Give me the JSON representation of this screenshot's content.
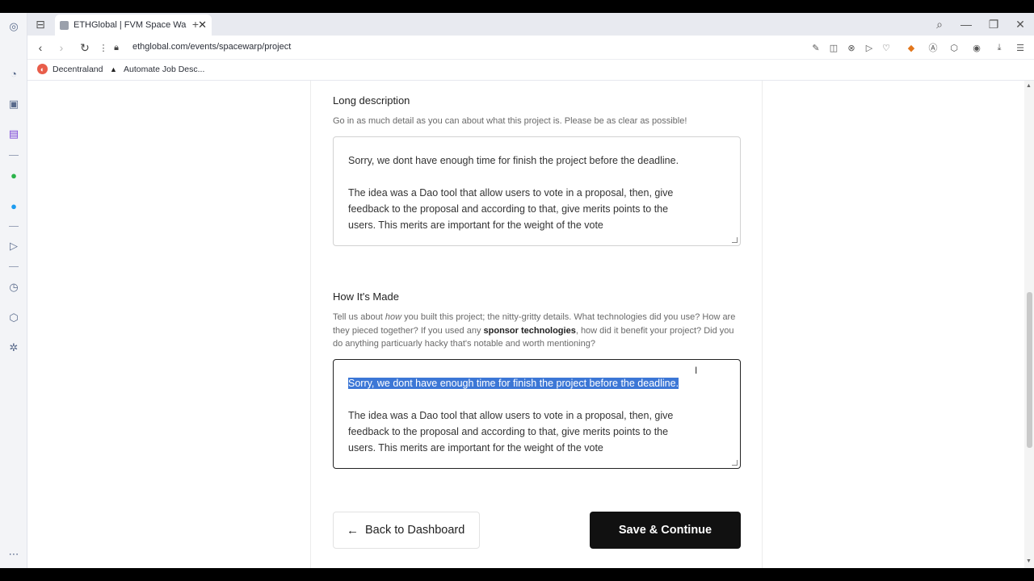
{
  "browser": {
    "tab_title": "ETHGlobal | FVM Space Wa",
    "url": "ethglobal.com/events/spacewarp/project",
    "bookmarks": [
      {
        "label": "Decentraland"
      },
      {
        "label": "Automate Job Desc..."
      }
    ]
  },
  "form": {
    "long_description": {
      "title": "Long description",
      "help": "Go in as much detail as you can about what this project is. Please be as clear as possible!",
      "line1": "Sorry, we dont have enough time for finish the project before the deadline.",
      "para2_line1": "The idea was a Dao tool that allow users to vote in a proposal, then, give",
      "para2_line2": "feedback to the proposal and according to that, give merits points to the",
      "para2_line3": "users. This merits are important for the weight of the vote"
    },
    "how_its_made": {
      "title": "How It's Made",
      "help_part1": "Tell us about ",
      "help_em": "how",
      "help_part2": " you built this project; the nitty-gritty details. What technologies did you use? How are they pieced together? If you used any ",
      "help_bold": "sponsor technologies",
      "help_part3": ", how did it benefit your project? Did you do anything particuarly hacky that's notable and worth mentioning?",
      "line1": "Sorry, we dont have enough time for finish the project before the deadline.",
      "para2_line1": "The idea was a Dao tool that allow users to vote in a proposal, then, give",
      "para2_line2": "feedback to the proposal and according to that, give merits points to the",
      "para2_line3": "users. This merits are important for the weight of the vote"
    },
    "back_label": "Back to Dashboard",
    "save_label": "Save & Continue"
  },
  "colors": {
    "selection": "#3c77d6",
    "primary_button": "#111111"
  }
}
